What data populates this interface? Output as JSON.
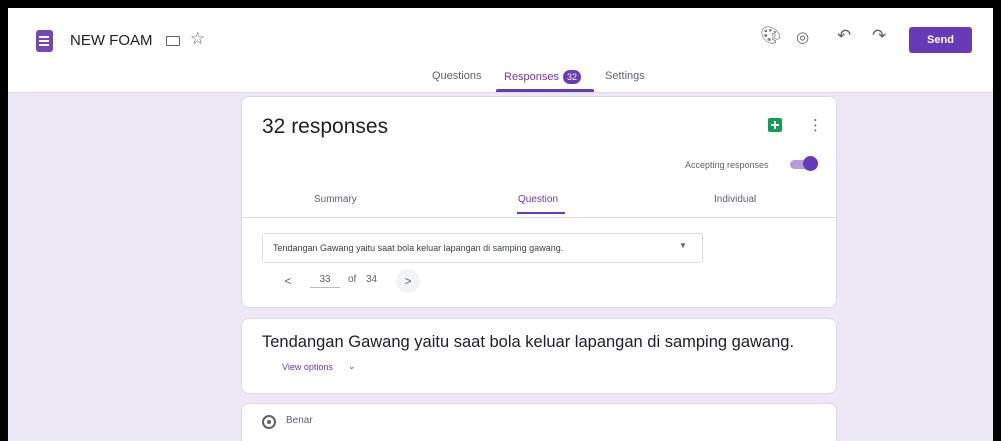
{
  "header": {
    "doc_title": "NEW FOAM",
    "send_label": "Send",
    "icons": [
      "forms-app-icon",
      "folder-icon",
      "star-icon",
      "palette-icon",
      "preview-eye-icon",
      "undo-icon",
      "redo-icon",
      "more-vert-icon"
    ]
  },
  "tabs": {
    "questions": "Questions",
    "responses": "Responses",
    "responses_count": "32",
    "settings": "Settings"
  },
  "summary_card": {
    "title": "32 responses",
    "accepting_label": "Accepting responses",
    "accepting": true,
    "sub_tabs": {
      "summary": "Summary",
      "question": "Question",
      "individual": "Individual"
    },
    "selected_question": "Tendangan Gawang yaitu saat bola keluar lapangan di samping gawang.",
    "pager": {
      "current": "33",
      "of": "of",
      "total": "34",
      "prev": "<",
      "next": ">"
    }
  },
  "question_card": {
    "question": "Tendangan Gawang yaitu saat bola keluar lapangan di samping gawang.",
    "view_options": "View options"
  },
  "option_card": {
    "option_label": "Benar"
  },
  "colors": {
    "accent": "#673ab7",
    "background": "#ede7f6",
    "sheets_green": "#0f9d58"
  }
}
